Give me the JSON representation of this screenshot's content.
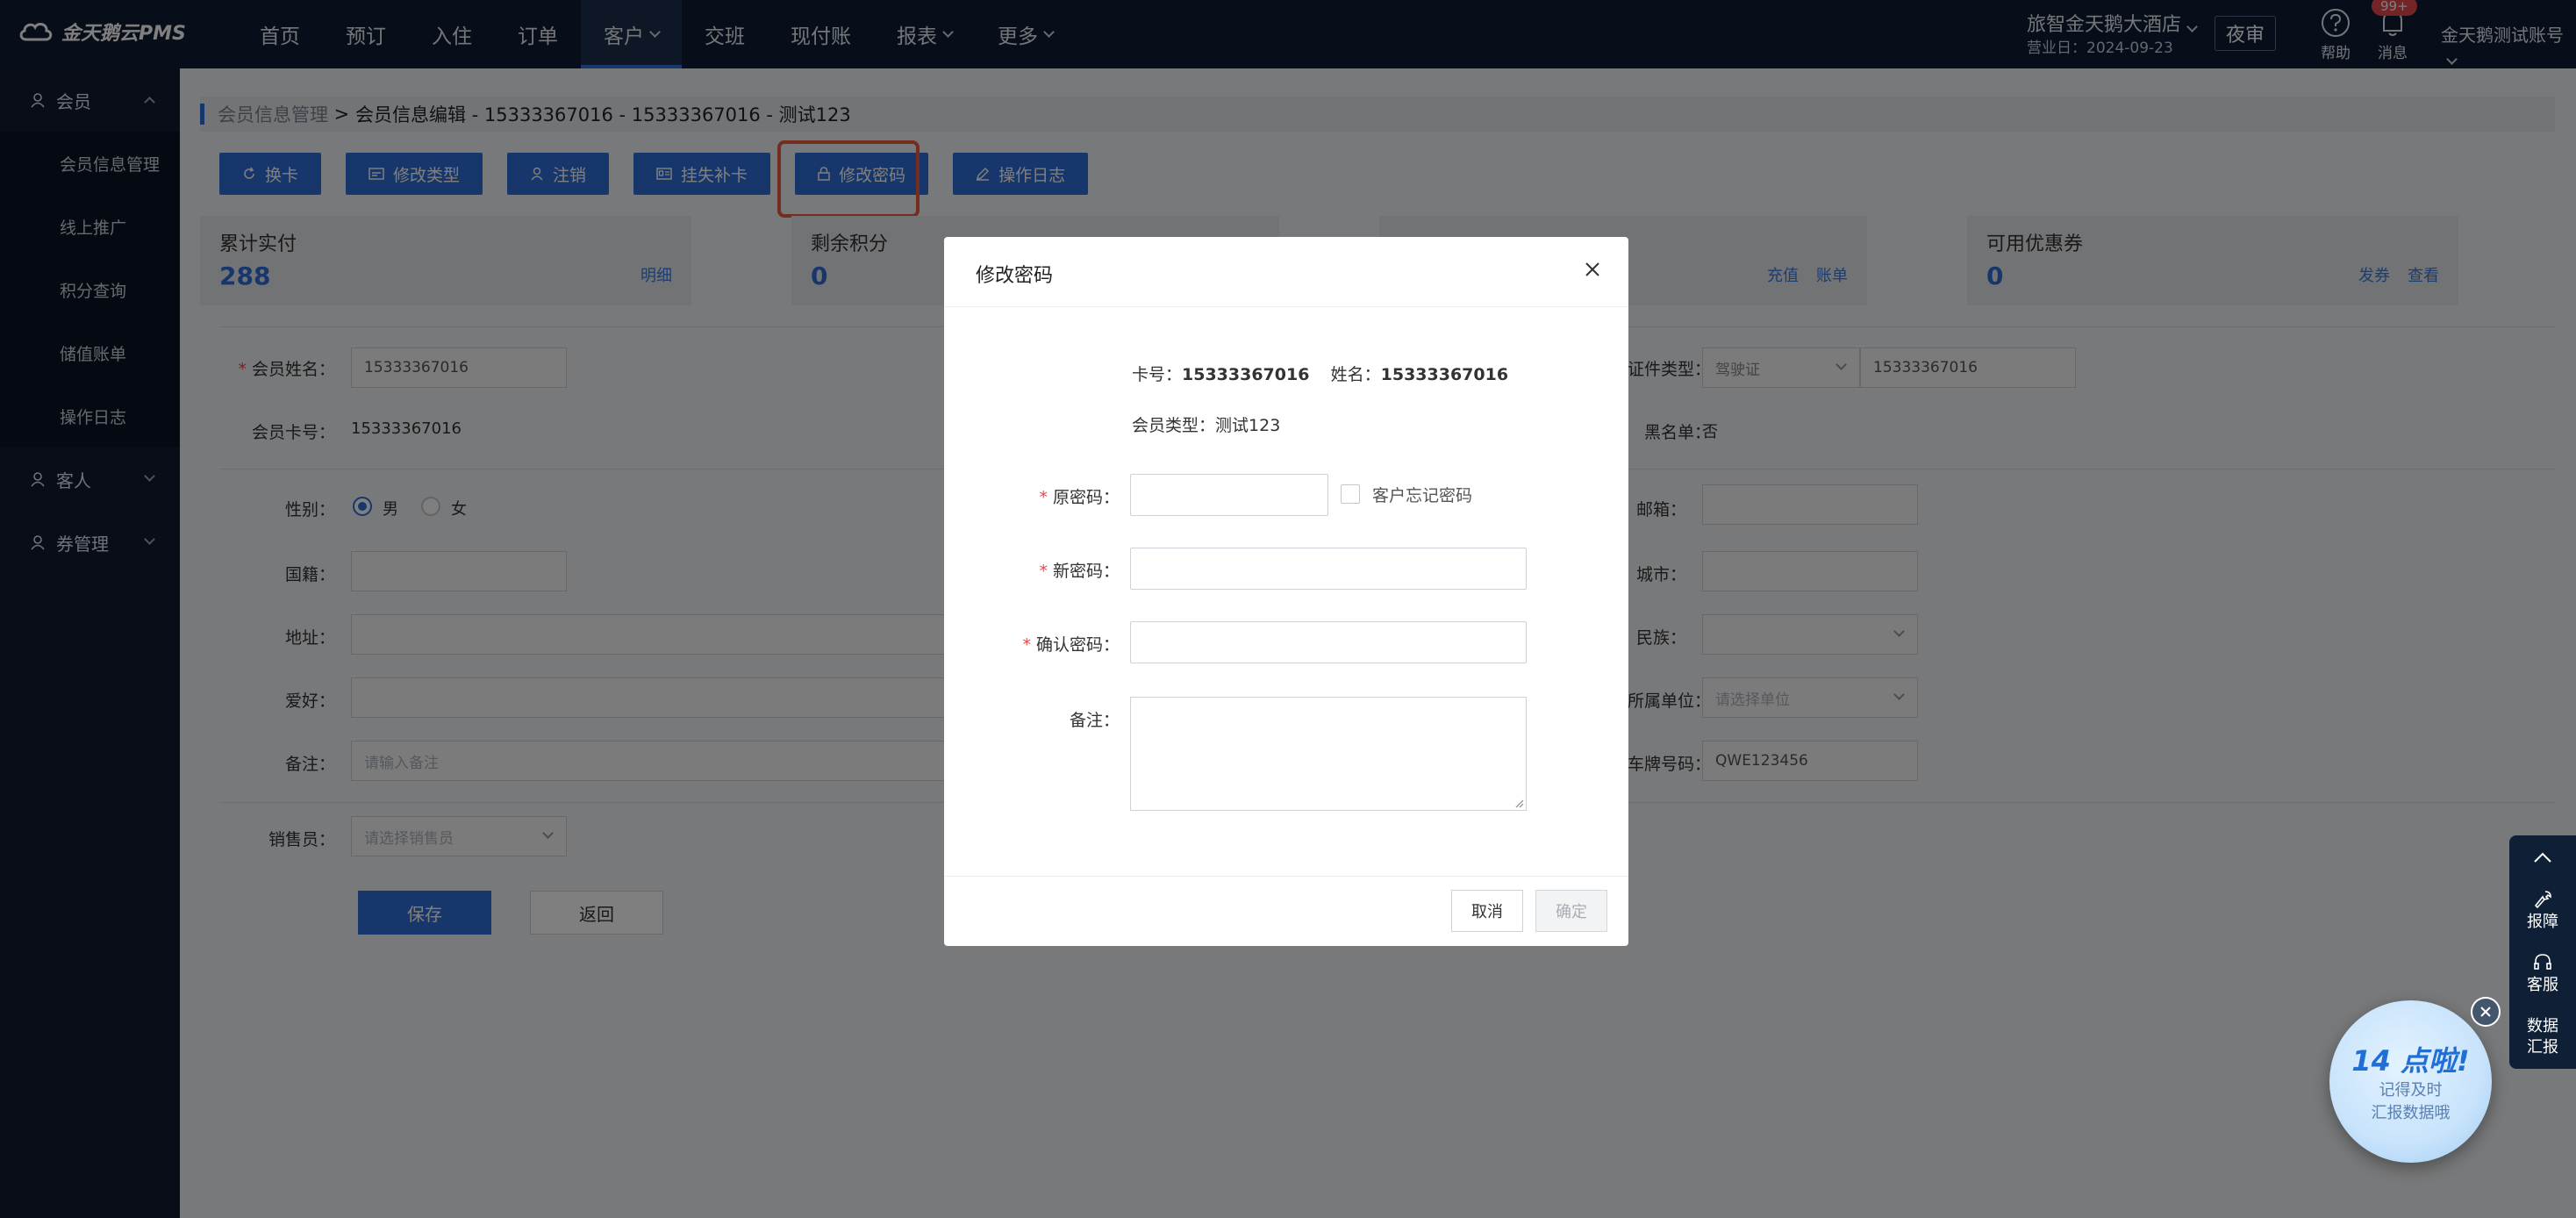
{
  "colors": {
    "topbar": "#0f1d33",
    "sidebar": "#101a2e",
    "accent": "#2f6fd8",
    "highlight": "#e85a3c",
    "danger": "#e5484d"
  },
  "app": {
    "logo": "金天鹅云PMS"
  },
  "nav": {
    "items": [
      "首页",
      "预订",
      "入住",
      "订单",
      "客户",
      "交班",
      "现付账",
      "报表",
      "更多"
    ],
    "active": "客户"
  },
  "header": {
    "hotel": "旅智金天鹅大酒店",
    "business_date": "营业日：2024-09-23",
    "night_audit": "夜审",
    "help": "帮助",
    "messages": "消息",
    "badge": "99+",
    "account": "金天鹅测试账号"
  },
  "sidebar": {
    "member": "会员",
    "member_items": [
      "会员信息管理",
      "线上推广",
      "积分查询",
      "储值账单",
      "操作日志"
    ],
    "guest": "客人",
    "coupon": "券管理"
  },
  "breadcrumb": {
    "parent": "会员信息管理",
    "sep": " > ",
    "current": "会员信息编辑 - 15333367016 - 15333367016 - 测试123"
  },
  "actions": [
    "换卡",
    "修改类型",
    "注销",
    "挂失补卡",
    "修改密码",
    "操作日志"
  ],
  "stats": {
    "total_paid": {
      "label": "累计实付",
      "value": "288",
      "link": "明细"
    },
    "points": {
      "label": "剩余积分",
      "value": "0"
    },
    "stored": {
      "label": "",
      "links": [
        "充值",
        "账单"
      ]
    },
    "coupons": {
      "label": "可用优惠券",
      "value": "0",
      "links": [
        "发券",
        "查看"
      ]
    }
  },
  "form": {
    "name_label": "会员姓名：",
    "name_value": "15333367016",
    "card_label": "会员卡号：",
    "card_value": "15333367016",
    "id_type_label": "证件类型：",
    "id_type_value": "驾驶证",
    "id_number": "15333367016",
    "blacklist_label": "黑名单：",
    "blacklist_value": "否",
    "gender_label": "性别：",
    "gender_male": "男",
    "gender_female": "女",
    "email_label": "邮箱：",
    "nationality_label": "国籍：",
    "city_label": "城市：",
    "address_label": "地址：",
    "ethnicity_label": "民族：",
    "hobby_label": "爱好：",
    "unit_label": "所属单位：",
    "unit_placeholder": "请选择单位",
    "remark_label": "备注：",
    "remark_placeholder": "请输入备注",
    "plate_label": "车牌号码：",
    "plate_value": "QWE123456",
    "sales_label": "销售员：",
    "sales_placeholder": "请选择销售员",
    "save": "保存",
    "back": "返回"
  },
  "modal": {
    "title": "修改密码",
    "info_card_label": "卡号：",
    "info_card": "15333367016",
    "info_name_label": "姓名：",
    "info_name": "15333367016",
    "info_type_label": "会员类型：",
    "info_type": "测试123",
    "old_pwd": "原密码：",
    "forgot": "客户忘记密码",
    "new_pwd": "新密码：",
    "confirm_pwd": "确认密码：",
    "remark": "备注：",
    "cancel": "取消",
    "ok": "确定"
  },
  "float": {
    "report": "报障",
    "service": "客服",
    "data": "数据\n汇报"
  },
  "promo": {
    "title": "14 点啦!",
    "line1": "记得及时",
    "line2": "汇报数据哦"
  }
}
